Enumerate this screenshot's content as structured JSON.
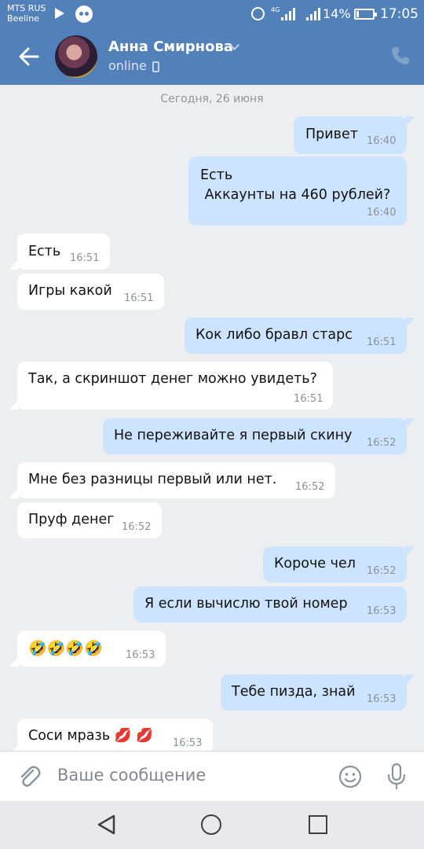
{
  "status_bar": {
    "carrier_1": "MTS RUS",
    "carrier_2": "Beeline",
    "network": "4G",
    "battery": "14%",
    "time": "17:05"
  },
  "header": {
    "contact_name": "Анна Смирнова",
    "status": "online"
  },
  "date_separator": "Сегодня, 26 июня",
  "messages": [
    {
      "dir": "out",
      "text": "Привет",
      "time": "16:40"
    },
    {
      "dir": "out",
      "text": "Есть\n Аккаунты на 460 рублей?",
      "time": "16:40"
    },
    {
      "dir": "in",
      "text": "Есть",
      "time": "16:51"
    },
    {
      "dir": "in",
      "text": "Игры какой",
      "time": "16:51"
    },
    {
      "dir": "out",
      "text": "Кок либо бравл старс",
      "time": "16:51"
    },
    {
      "dir": "in",
      "text": "Так, а скриншот денег можно увидеть?",
      "time": "16:51"
    },
    {
      "dir": "out",
      "text": "Не переживайте я первый скину",
      "time": "16:52"
    },
    {
      "dir": "in",
      "text": "Мне без разницы первый или нет.",
      "time": "16:52"
    },
    {
      "dir": "in",
      "text": "Пруф денег",
      "time": "16:52"
    },
    {
      "dir": "out",
      "text": "Короче чел",
      "time": "16:52"
    },
    {
      "dir": "out",
      "text": "Я если вычислю твой номер",
      "time": "16:53"
    },
    {
      "dir": "in",
      "text": "🤣🤣🤣🤣",
      "time": "16:53"
    },
    {
      "dir": "out",
      "text": "Тебе пизда, знай",
      "time": "16:53"
    },
    {
      "dir": "in",
      "text": "Соси мразь 💋 💋",
      "time": "16:53"
    }
  ],
  "input": {
    "placeholder": "Ваше сообщение"
  },
  "colors": {
    "header_bg": "#5181b8",
    "outgoing_bubble": "#cce4ff",
    "incoming_bubble": "#ffffff",
    "chat_bg": "#edeef0"
  },
  "icons": [
    "back-arrow-icon",
    "phone-icon",
    "mobile-device-icon",
    "paperclip-icon",
    "smiley-icon",
    "microphone-icon",
    "nav-back-icon",
    "nav-home-icon",
    "nav-recents-icon"
  ]
}
